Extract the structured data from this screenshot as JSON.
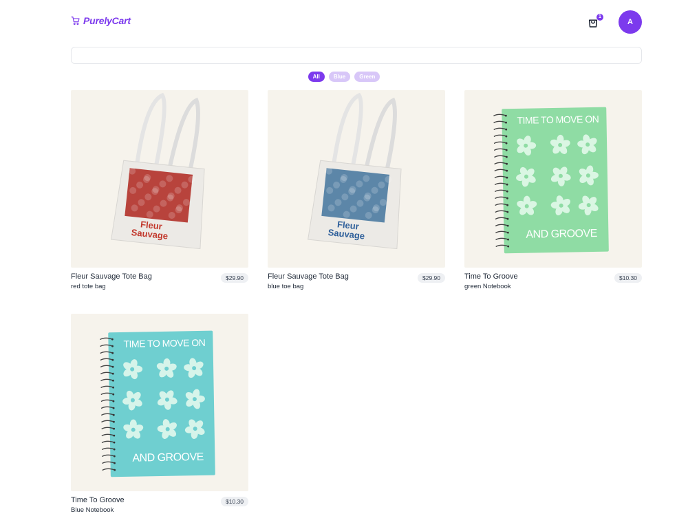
{
  "header": {
    "brand": "PurelyCart",
    "cart_count": "1",
    "avatar_initial": "A"
  },
  "search": {
    "value": "",
    "placeholder": ""
  },
  "filters": [
    {
      "label": "All",
      "active": true
    },
    {
      "label": "Blue",
      "active": false
    },
    {
      "label": "Green",
      "active": false
    }
  ],
  "products": [
    {
      "name": "Fleur Sauvage Tote Bag",
      "price": "$29.90",
      "description": "red tote bag",
      "image": {
        "kind": "tote",
        "print_text": [
          "Fleur",
          "Sauvage"
        ],
        "print_color": "#c2372b",
        "photo_color": "#b8433c"
      }
    },
    {
      "name": "Fleur Sauvage Tote Bag",
      "price": "$29.90",
      "description": "blue toe bag",
      "image": {
        "kind": "tote",
        "print_text": [
          "Fleur",
          "Sauvage"
        ],
        "print_color": "#2e5f9a",
        "photo_color": "#5c86a8"
      }
    },
    {
      "name": "Time To Groove",
      "price": "$10.30",
      "description": "green Notebook",
      "image": {
        "kind": "notebook",
        "top_text": "TIME TO MOVE ON",
        "bottom_text": "AND GROOVE",
        "cover_color": "#8fdca4"
      }
    },
    {
      "name": "Time To Groove",
      "price": "$10.30",
      "description": "Blue Notebook",
      "image": {
        "kind": "notebook",
        "top_text": "TIME TO MOVE ON",
        "bottom_text": "AND GROOVE",
        "cover_color": "#6fcfd0"
      }
    }
  ],
  "colors": {
    "accent": "#7c3aed",
    "accent_light": "#d8c7f8"
  }
}
